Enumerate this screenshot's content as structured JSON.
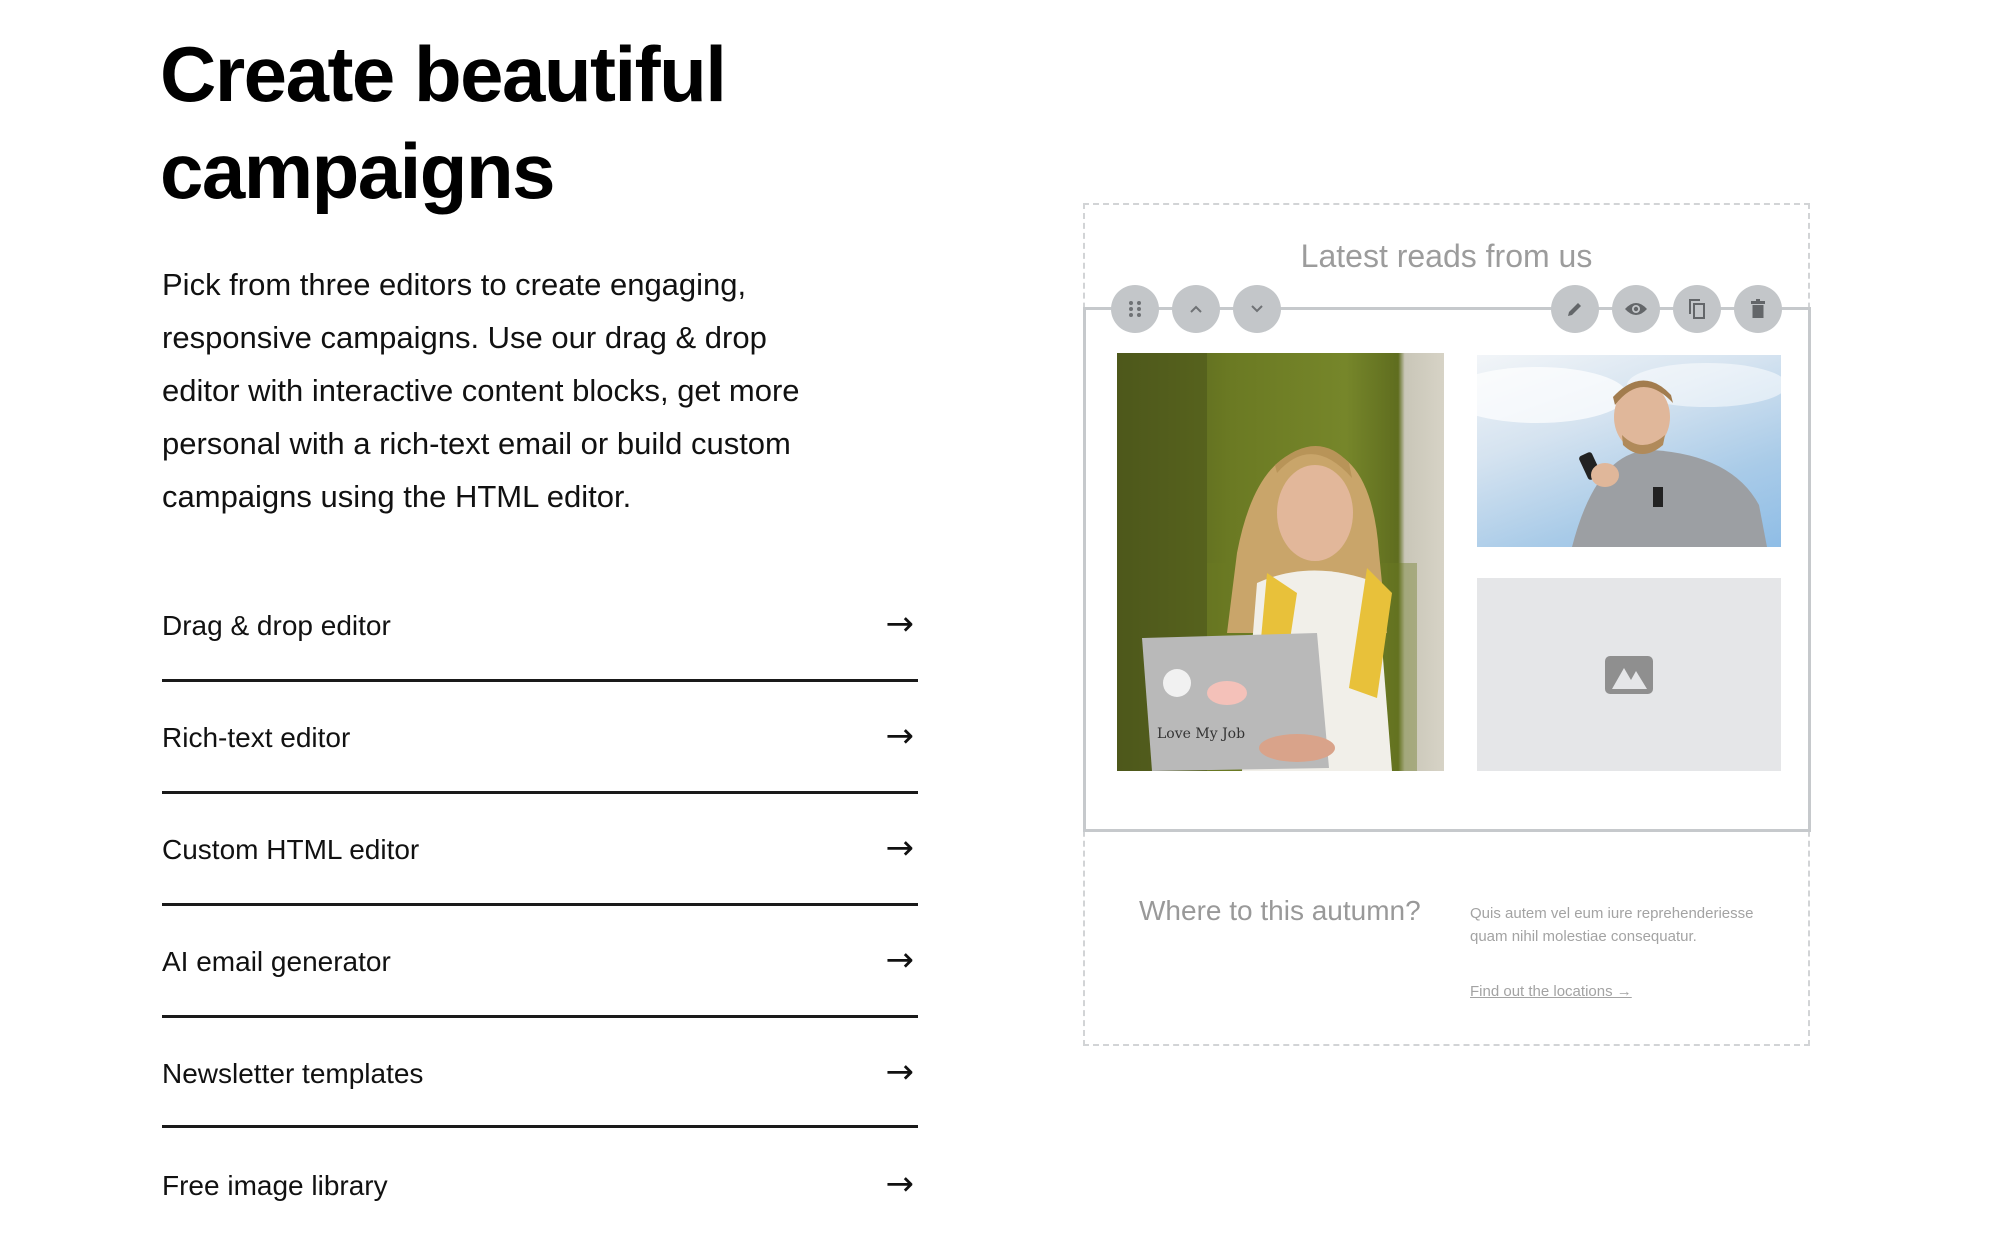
{
  "hero": {
    "heading_lines": [
      "Create beautiful",
      "campaigns"
    ],
    "intro_lines": [
      "Pick from three editors to create engaging,",
      "responsive campaigns. Use our drag & drop",
      "editor with interactive content blocks, get more",
      "personal with a rich-text email or build custom",
      "campaigns using the HTML editor."
    ]
  },
  "features": [
    {
      "label": "Drag & drop editor",
      "arrow": "→"
    },
    {
      "label": "Rich-text editor",
      "arrow": "→"
    },
    {
      "label": "Custom HTML editor",
      "arrow": "→"
    },
    {
      "label": "AI email generator",
      "arrow": "→"
    },
    {
      "label": "Newsletter templates",
      "arrow": "→"
    },
    {
      "label": "Free image library",
      "arrow": "→"
    }
  ],
  "editor_preview": {
    "block_title": "Latest reads from us",
    "toolbar_left": [
      "drag-handle-icon",
      "chevron-up-icon",
      "chevron-down-icon"
    ],
    "toolbar_right": [
      "pencil-icon",
      "eye-icon",
      "copy-icon",
      "trash-icon"
    ],
    "images": [
      {
        "name": "photo-woman-laptop",
        "description": "Woman smiling with a sticker-covered laptop on a green sofa"
      },
      {
        "name": "photo-man-phone",
        "description": "Man looking at phone against a blue sky"
      },
      {
        "name": "image-placeholder",
        "description": "Empty image placeholder"
      }
    ],
    "footer": {
      "title": "Where to this autumn?",
      "text": "Quis autem vel eum iure reprehenderiesse quam nihil molestiae consequatur.",
      "link": "Find out the locations →"
    }
  },
  "colors": {
    "text": "#000000",
    "muted_text": "#9c9c9c",
    "toolbar_button": "#c3c6c9",
    "placeholder_bg": "#e5e6e8",
    "divider": "#1a1a1a"
  }
}
